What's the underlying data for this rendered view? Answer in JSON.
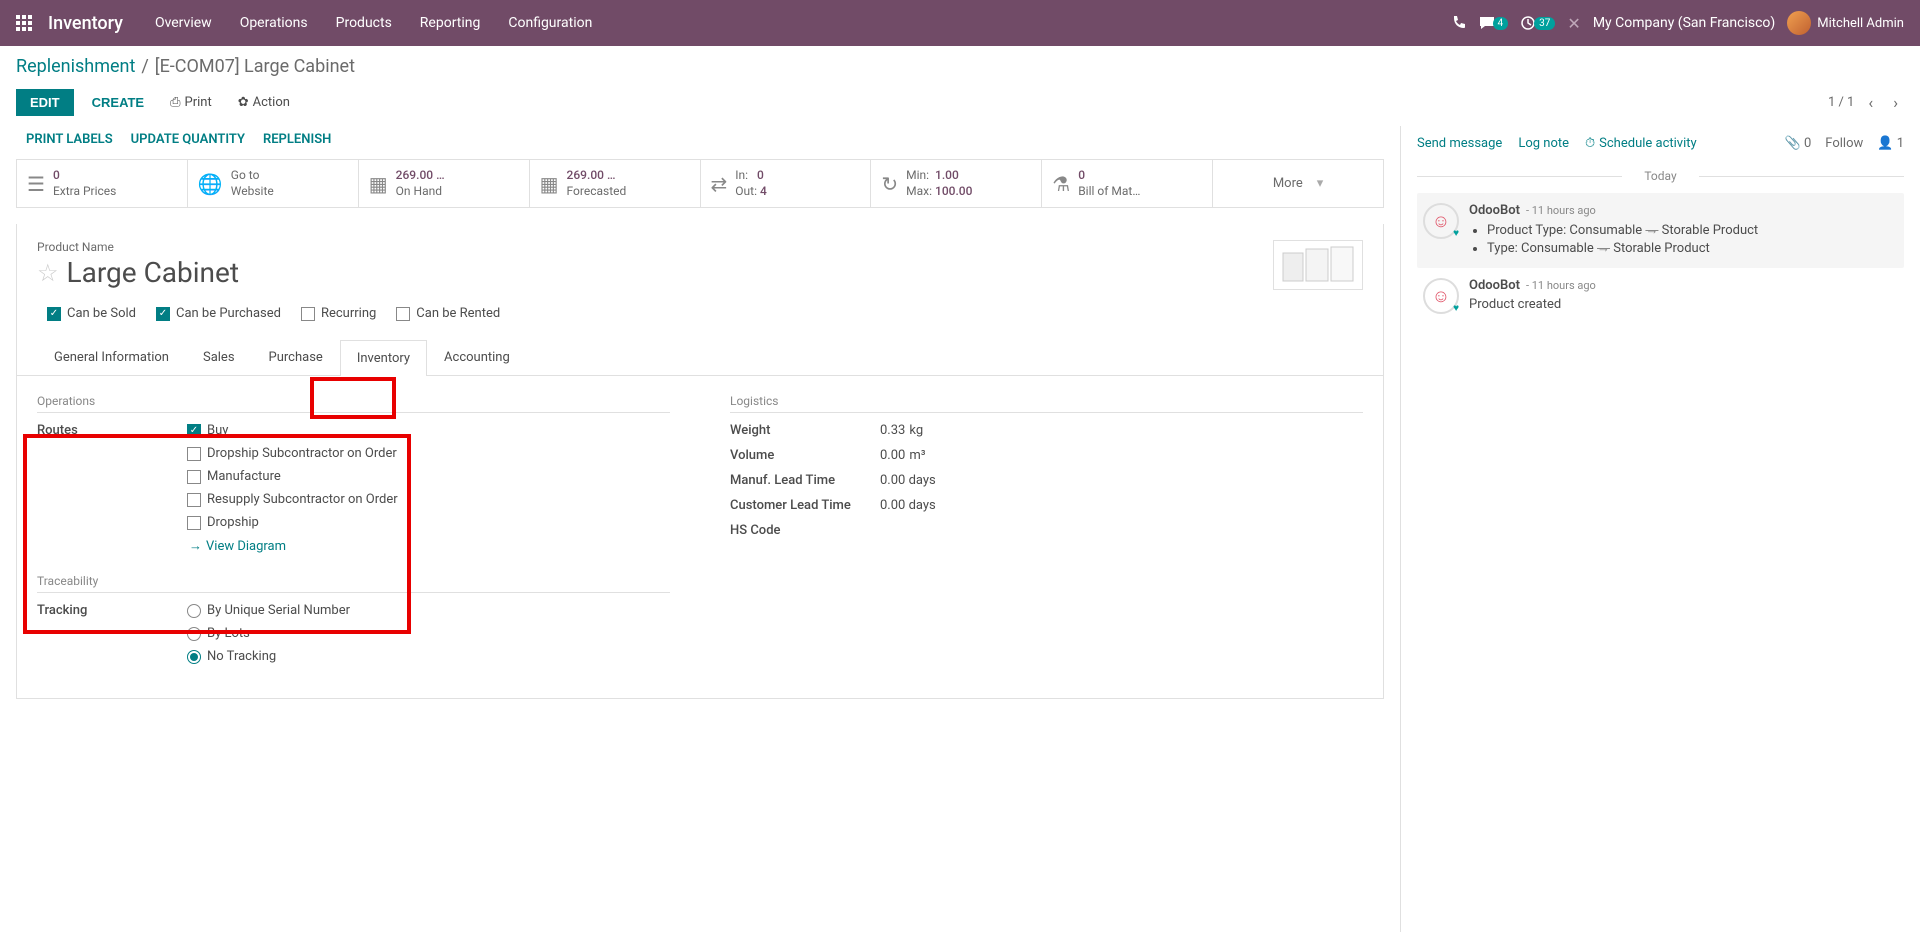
{
  "topbar": {
    "app_title": "Inventory",
    "menu": [
      "Overview",
      "Operations",
      "Products",
      "Reporting",
      "Configuration"
    ],
    "messages_badge": "4",
    "activities_badge": "37",
    "company": "My Company (San Francisco)",
    "user": "Mitchell Admin"
  },
  "breadcrumb": {
    "parent": "Replenishment",
    "current": "[E-COM07] Large Cabinet"
  },
  "actions": {
    "edit": "EDIT",
    "create": "CREATE",
    "print": "Print",
    "action": "Action",
    "pager": "1 / 1"
  },
  "status_actions": {
    "print_labels": "PRINT LABELS",
    "update_qty": "UPDATE QUANTITY",
    "replenish": "REPLENISH"
  },
  "button_box": {
    "extra_prices_val": "0",
    "extra_prices": "Extra Prices",
    "website_l1": "Go to",
    "website_l2": "Website",
    "onhand_val": "269.00 …",
    "onhand": "On Hand",
    "forecast_val": "269.00 …",
    "forecast": "Forecasted",
    "in_lbl": "In:",
    "in_val": "0",
    "out_lbl": "Out:",
    "out_val": "4",
    "min_lbl": "Min:",
    "min_val": "1.00",
    "max_lbl": "Max:",
    "max_val": "100.00",
    "bom_val": "0",
    "bom": "Bill of Mat…",
    "more": "More"
  },
  "product": {
    "name_label": "Product Name",
    "name": "Large Cabinet"
  },
  "options": {
    "sold": "Can be Sold",
    "purchased": "Can be Purchased",
    "recurring": "Recurring",
    "rented": "Can be Rented"
  },
  "tabs": {
    "general": "General Information",
    "sales": "Sales",
    "purchase": "Purchase",
    "inventory": "Inventory",
    "accounting": "Accounting"
  },
  "operations": {
    "title": "Operations",
    "routes_label": "Routes",
    "routes": {
      "buy": "Buy",
      "dropship_sub": "Dropship Subcontractor on Order",
      "manufacture": "Manufacture",
      "resupply_sub": "Resupply Subcontractor on Order",
      "dropship": "Dropship"
    },
    "view_diagram": "View Diagram"
  },
  "traceability": {
    "title": "Traceability",
    "tracking_label": "Tracking",
    "tracking": {
      "serial": "By Unique Serial Number",
      "lots": "By Lots",
      "none": "No Tracking"
    }
  },
  "logistics": {
    "title": "Logistics",
    "weight_label": "Weight",
    "weight": "0.33",
    "weight_unit": "kg",
    "volume_label": "Volume",
    "volume": "0.00",
    "volume_unit": "m³",
    "manuf_lead_label": "Manuf. Lead Time",
    "manuf_lead": "0.00 days",
    "cust_lead_label": "Customer Lead Time",
    "cust_lead": "0.00 days",
    "hscode_label": "HS Code"
  },
  "chatter": {
    "send": "Send message",
    "log": "Log note",
    "schedule": "Schedule activity",
    "attach_count": "0",
    "follow": "Follow",
    "follower_count": "1",
    "today": "Today",
    "msg1": {
      "author": "OdooBot",
      "time": "- 11 hours ago",
      "line1a": "Product Type: Consumable",
      "line1b": "Storable Product",
      "line2a": "Type: Consumable",
      "line2b": "Storable Product"
    },
    "msg2": {
      "author": "OdooBot",
      "time": "- 11 hours ago",
      "text": "Product created"
    }
  }
}
